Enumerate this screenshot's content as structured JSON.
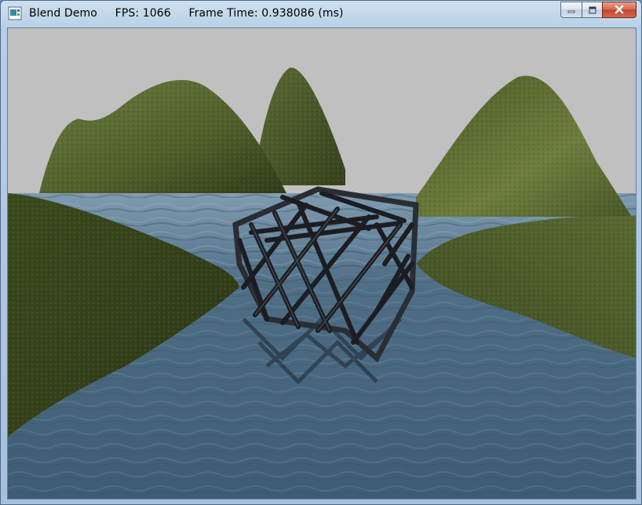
{
  "window": {
    "title_text": "Blend Demo     FPS: 1066     Frame Time: 0.938086 (ms)",
    "app_icon": "window-app-icon",
    "controls": {
      "minimize_icon": "minimize-icon",
      "maximize_icon": "maximize-icon",
      "close_icon": "close-icon"
    }
  },
  "scene": {
    "description_icons": [
      "terrain",
      "water",
      "wire-fence-crate"
    ],
    "colors": {
      "sky": "#c0c0c0",
      "grass_dark": "#3a4a1f",
      "grass_mid": "#5f6f3a",
      "grass_light": "#79874a",
      "water_dark": "#2f4e66",
      "water_mid": "#4f6f86",
      "water_light": "#7f9bb0",
      "crate": "#1b1d22"
    }
  }
}
